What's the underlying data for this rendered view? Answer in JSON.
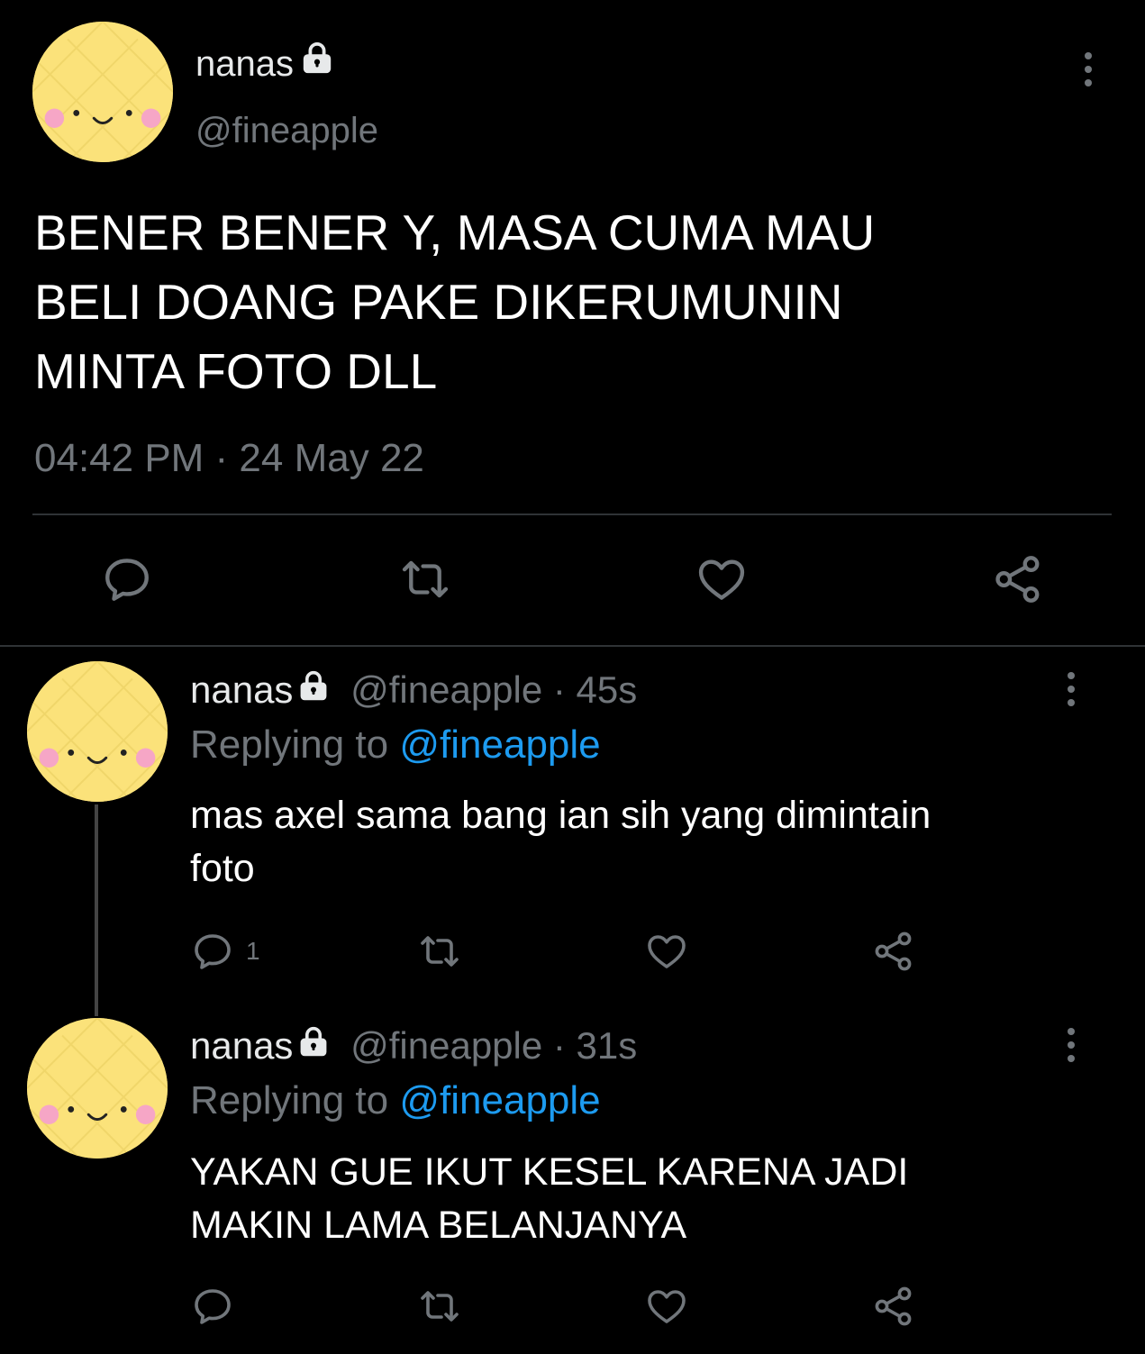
{
  "main_tweet": {
    "display_name": "nanas",
    "handle": "@fineapple",
    "text_lines": [
      "BENER BENER Y, MASA CUMA MAU",
      "BELI DOANG PAKE DIKERUMUNIN",
      "MINTA FOTO DLL"
    ],
    "timestamp": "04:42 PM · 24 May 22"
  },
  "replies": [
    {
      "display_name": "nanas",
      "meta": "@fineapple · 45s",
      "replying_prefix": "Replying to",
      "replying_handle": "@fineapple",
      "text_lines": [
        "mas axel sama bang ian sih yang dimintain",
        "foto"
      ],
      "reply_count": "1"
    },
    {
      "display_name": "nanas",
      "meta": "@fineapple · 31s",
      "replying_prefix": "Replying to",
      "replying_handle": "@fineapple",
      "text_lines": [
        "YAKAN GUE IKUT KESEL KARENA JADI",
        "MAKIN LAMA BELANJANYA"
      ],
      "reply_count": ""
    }
  ],
  "icons": {
    "lock": "lock-icon",
    "more": "more-vertical-icon",
    "reply": "reply-icon",
    "retweet": "retweet-icon",
    "like": "heart-icon",
    "share": "share-icon"
  },
  "colors": {
    "background": "#000000",
    "text": "#e7e9ea",
    "muted": "#71767b",
    "link": "#1d9bf0",
    "avatar": "#fbe27a",
    "divider": "#2f3336"
  }
}
